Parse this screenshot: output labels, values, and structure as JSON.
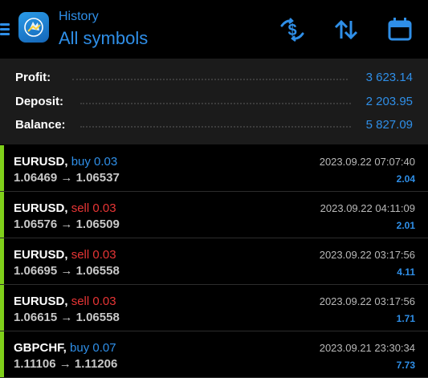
{
  "header": {
    "subtitle": "History",
    "title": "All symbols",
    "icons": [
      "menu-icon",
      "app-logo",
      "currency-filter-icon",
      "sort-icon",
      "calendar-icon"
    ],
    "accent_color": "#2f8fe8"
  },
  "summary": {
    "rows": [
      {
        "label": "Profit:",
        "value": "3 623.14"
      },
      {
        "label": "Deposit:",
        "value": "2 203.95"
      },
      {
        "label": "Balance:",
        "value": "5 827.09"
      }
    ]
  },
  "trades": [
    {
      "symbol": "EURUSD,",
      "direction": "buy",
      "volume": "0.03",
      "open": "1.06469",
      "close": "1.06537",
      "time": "2023.09.22 07:07:40",
      "profit": "2.04"
    },
    {
      "symbol": "EURUSD,",
      "direction": "sell",
      "volume": "0.03",
      "open": "1.06576",
      "close": "1.06509",
      "time": "2023.09.22 04:11:09",
      "profit": "2.01"
    },
    {
      "symbol": "EURUSD,",
      "direction": "sell",
      "volume": "0.03",
      "open": "1.06695",
      "close": "1.06558",
      "time": "2023.09.22 03:17:56",
      "profit": "4.11"
    },
    {
      "symbol": "EURUSD,",
      "direction": "sell",
      "volume": "0.03",
      "open": "1.06615",
      "close": "1.06558",
      "time": "2023.09.22 03:17:56",
      "profit": "1.71"
    },
    {
      "symbol": "GBPCHF,",
      "direction": "buy",
      "volume": "0.07",
      "open": "1.11106",
      "close": "1.11206",
      "time": "2023.09.21 23:30:34",
      "profit": "7.73"
    }
  ],
  "arrow": "→",
  "colors": {
    "buy": "#2f8fe8",
    "sell": "#e83535",
    "profit_bar": "#7fd01a"
  }
}
